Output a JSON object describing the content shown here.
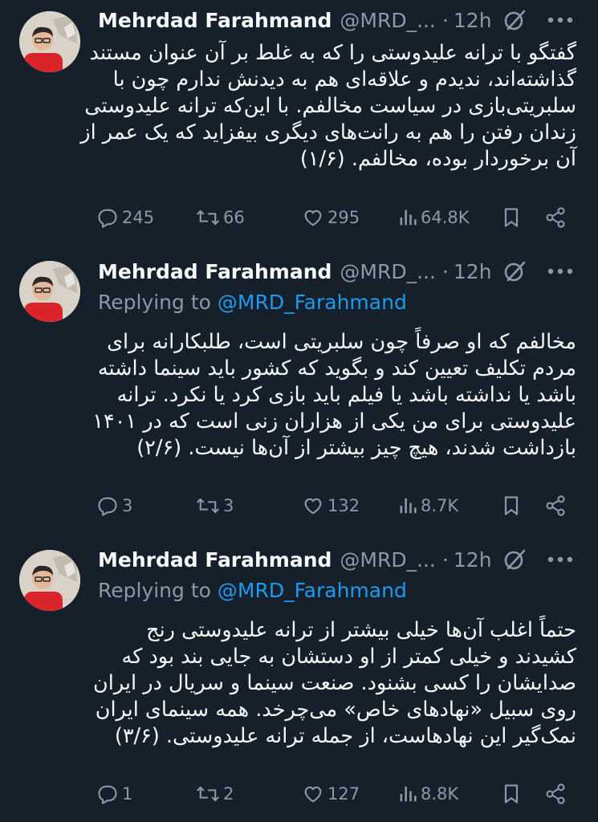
{
  "tweets": [
    {
      "author_name": "Mehrdad Farahmand",
      "handle": "@MRD_...",
      "dot": "·",
      "time": "12h",
      "replying_label": "",
      "replying_to": "",
      "lines": [
        "گفتگو با ترانه علیدوستی را که به غلط بر آن عنوان مستند",
        "گذاشته‌اند، ندیدم و علاقه‌ای هم به دیدنش ندارم چون با",
        "سلبریتی‌بازی در سیاست مخالفم. با این‌که ترانه علیدوستی",
        "زندان رفتن را هم به رانت‌های دیگری بیفزاید که یک عمر از",
        "آن برخوردار بوده، مخالفم. (۱/۶)"
      ],
      "stats": {
        "replies": "245",
        "reposts": "66",
        "likes": "295",
        "views": "64.8K"
      }
    },
    {
      "author_name": "Mehrdad Farahmand",
      "handle": "@MRD_...",
      "dot": "·",
      "time": "12h",
      "replying_label": "Replying to ",
      "replying_to": "@MRD_Farahmand",
      "lines": [
        "مخالفم که او صرفاً چون سلبریتی است، طلبکارانه برای",
        "مردم تکلیف تعیین کند و بگوید که کشور باید سینما داشته",
        "باشد یا نداشته باشد یا فیلم باید بازی کرد یا نکرد. ترانه",
        "علیدوستی برای من یکی از هزاران زنی است که در ۱۴۰۱",
        "بازداشت شدند، هیچ چیز بیشتر از آن‌ها نیست. (۲/۶)"
      ],
      "stats": {
        "replies": "3",
        "reposts": "3",
        "likes": "132",
        "views": "8.7K"
      }
    },
    {
      "author_name": "Mehrdad Farahmand",
      "handle": "@MRD_...",
      "dot": "·",
      "time": "12h",
      "replying_label": "Replying to ",
      "replying_to": "@MRD_Farahmand",
      "lines": [
        "حتماً اغلب آن‌ها خیلی بیشتر از ترانه علیدوستی رنج",
        "کشیدند و خیلی کمتر از او دستشان به جایی بند بود که",
        "صدایشان را کسی بشنود.  صنعت سینما و سریال در ایران",
        "روی سبیل «نهادهای خاص» می‌چرخد. همه سینمای ایران",
        "نمک‌گیر این نهادهاست، از جمله ترانه علیدوستی. (۳/۶)"
      ],
      "stats": {
        "replies": "1",
        "reposts": "2",
        "likes": "127",
        "views": "8.8K"
      }
    }
  ],
  "icons": {
    "avatar": "avatar",
    "grok": "grok-icon",
    "more": "more-icon",
    "reply": "reply-icon",
    "repost": "repost-icon",
    "like": "like-icon",
    "views": "views-icon",
    "bookmark": "bookmark-icon",
    "share": "share-icon"
  },
  "colors": {
    "background": "#15202b",
    "text": "#f7f9f9",
    "secondary": "#8b98a5",
    "link": "#1d9bf0"
  }
}
